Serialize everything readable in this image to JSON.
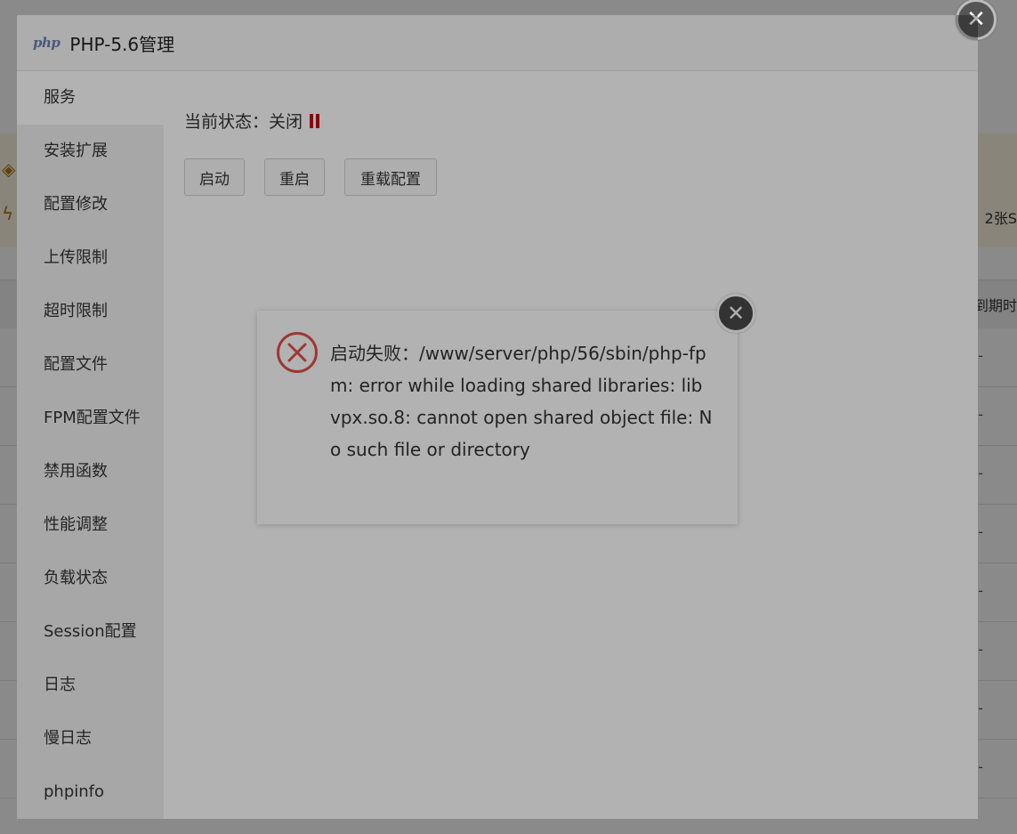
{
  "background": {
    "banner_right_text": "2张S",
    "table_header_right_text": "到期时",
    "row_dash": "-"
  },
  "modal": {
    "logo_text": "php",
    "title": "PHP-5.6管理",
    "close_glyph": "✕"
  },
  "sidebar": {
    "items": [
      {
        "label": "服务",
        "active": true
      },
      {
        "label": "安装扩展"
      },
      {
        "label": "配置修改"
      },
      {
        "label": "上传限制"
      },
      {
        "label": "超时限制"
      },
      {
        "label": "配置文件"
      },
      {
        "label": "FPM配置文件"
      },
      {
        "label": "禁用函数"
      },
      {
        "label": "性能调整"
      },
      {
        "label": "负载状态"
      },
      {
        "label": "Session配置"
      },
      {
        "label": "日志"
      },
      {
        "label": "慢日志"
      },
      {
        "label": "phpinfo"
      }
    ]
  },
  "service": {
    "status_label": "当前状态：",
    "status_value": "关闭",
    "status_icon": "pause-icon",
    "status_color": "#d40000",
    "buttons": {
      "start": "启动",
      "restart": "重启",
      "reload": "重载配置"
    }
  },
  "dialog": {
    "icon": "error-icon",
    "icon_color": "#e2504c",
    "message": "启动失败：/www/server/php/56/sbin/php-fpm: error while loading shared libraries: libvpx.so.8: cannot open shared object file: No such file or directory",
    "close_glyph": "✕"
  }
}
